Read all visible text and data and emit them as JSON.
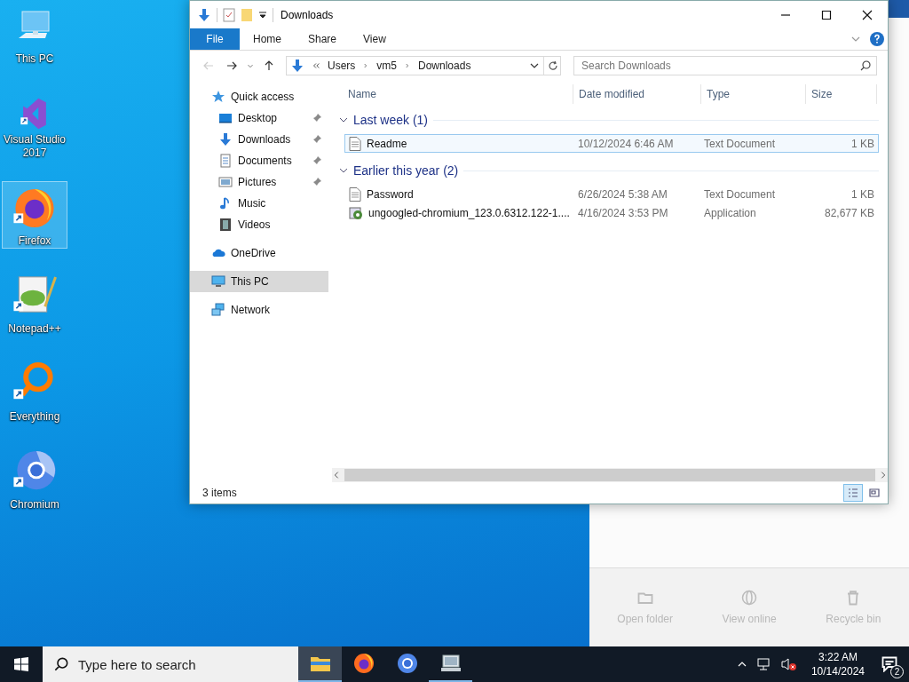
{
  "desktop_icons": [
    {
      "label": "This PC",
      "kind": "computer",
      "selected": false
    },
    {
      "label": "Visual Studio 2017",
      "kind": "studio",
      "selected": false
    },
    {
      "label": "Firefox",
      "kind": "firefox",
      "selected": true
    },
    {
      "label": "Notepad++",
      "kind": "notepad",
      "selected": false
    },
    {
      "label": "Everything",
      "kind": "everything",
      "selected": false
    },
    {
      "label": "Chromium",
      "kind": "chromium",
      "selected": false
    }
  ],
  "sync_panel": {
    "buttons": [
      {
        "label": "Open folder",
        "kind": "folder",
        "disabled": true
      },
      {
        "label": "View online",
        "kind": "globe",
        "disabled": true
      },
      {
        "label": "Recycle bin",
        "kind": "bin",
        "disabled": true
      }
    ]
  },
  "explorer": {
    "title": "Downloads",
    "ribbon_tabs": [
      {
        "label": "File",
        "selected": true
      },
      {
        "label": "Home",
        "selected": false
      },
      {
        "label": "Share",
        "selected": false
      },
      {
        "label": "View",
        "selected": false
      }
    ],
    "address": {
      "path": [
        "Users",
        "vm5",
        "Downloads"
      ]
    },
    "search": {
      "placeholder": "Search Downloads"
    },
    "nav": [
      {
        "label": "Quick access",
        "kind": "star",
        "selected": false,
        "children": [
          {
            "label": "Desktop",
            "kind": "desktop",
            "pinned": true,
            "selected": false
          },
          {
            "label": "Downloads",
            "kind": "download",
            "pinned": true,
            "selected": false
          },
          {
            "label": "Documents",
            "kind": "document",
            "pinned": true,
            "selected": false
          },
          {
            "label": "Pictures",
            "kind": "picture",
            "pinned": true,
            "selected": false
          },
          {
            "label": "Music",
            "kind": "music",
            "pinned": false,
            "selected": false
          },
          {
            "label": "Videos",
            "kind": "video",
            "pinned": false,
            "selected": false
          }
        ]
      },
      {
        "label": "OneDrive",
        "kind": "cloud",
        "selected": false
      },
      {
        "label": "This PC",
        "kind": "computer",
        "selected": true
      },
      {
        "label": "Network",
        "kind": "network",
        "selected": false
      }
    ],
    "columns": [
      "Name",
      "Date modified",
      "Type",
      "Size"
    ],
    "groups": [
      {
        "label": "Last week (1)",
        "expanded": true,
        "rows": [
          {
            "name": "Readme",
            "date": "10/12/2024 6:46 AM",
            "type": "Text Document",
            "size": "1 KB",
            "kind": "text",
            "selected": true
          }
        ]
      },
      {
        "label": "Earlier this year (2)",
        "expanded": true,
        "rows": [
          {
            "name": "Password",
            "date": "6/26/2024 5:38 AM",
            "type": "Text Document",
            "size": "1 KB",
            "kind": "text",
            "selected": false
          },
          {
            "name": "ungoogled-chromium_123.0.6312.122-1....",
            "date": "4/16/2024 3:53 PM",
            "type": "Application",
            "size": "82,677 KB",
            "kind": "app",
            "selected": false
          }
        ]
      }
    ],
    "status": "3 items",
    "views": [
      {
        "kind": "details",
        "selected": true
      },
      {
        "kind": "tiles",
        "selected": false
      }
    ]
  },
  "taskbar": {
    "search": {
      "placeholder": "Type here to search"
    },
    "apps": [
      {
        "kind": "explorer",
        "active": true,
        "running": true
      },
      {
        "kind": "firefox",
        "active": false,
        "running": false
      },
      {
        "kind": "chromium",
        "active": false,
        "running": false
      },
      {
        "kind": "monitor",
        "active": false,
        "running": true
      }
    ],
    "time": "3:22 AM",
    "date": "10/14/2024",
    "notifications": "2"
  }
}
